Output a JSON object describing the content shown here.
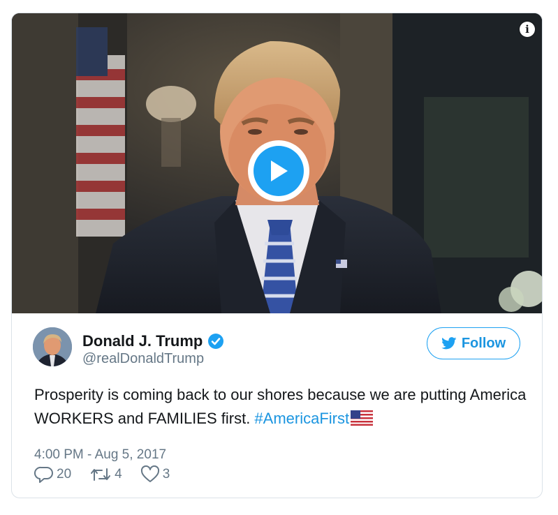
{
  "tweet": {
    "info_icon": "info-icon",
    "play_icon": "play-icon",
    "author": {
      "name": "Donald J. Trump",
      "handle": "@realDonaldTrump",
      "verified_icon": "verified-badge-icon"
    },
    "follow_label": "Follow",
    "text_main": "Prosperity is coming back to our shores because we are putting America WORKERS and FAMILIES first. ",
    "hashtag": "#AmericaFirst",
    "emoji": "us-flag-emoji",
    "timestamp": "4:00 PM - Aug 5, 2017",
    "actions": {
      "reply_count": "20",
      "retweet_count": "4",
      "like_count": "3"
    },
    "colors": {
      "accent": "#1da1f2",
      "link": "#1b95e0",
      "text": "#14171a",
      "muted": "#657786",
      "border": "#dbe2e8"
    }
  }
}
